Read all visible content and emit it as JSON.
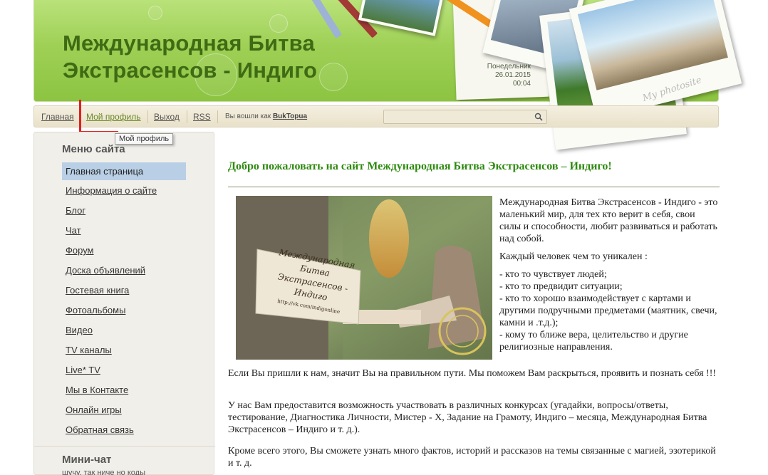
{
  "header": {
    "title_line1": "Международная Битва",
    "title_line2": "Экстрасенсов - Индиго",
    "weekday": "Понедельник",
    "date": "26.01.2015",
    "time": "00:04",
    "photo_caption": "My photosite"
  },
  "nav": {
    "home": "Главная",
    "profile": "Мой профиль",
    "logout": "Выход",
    "rss": "RSS",
    "logged_in_prefix": "Вы вошли как",
    "username": "BukTopua",
    "search_placeholder": "",
    "tooltip": "Мой профиль"
  },
  "sidebar": {
    "menu_title": "Меню сайта",
    "items": [
      {
        "label": "Главная страница"
      },
      {
        "label": "Информация о сайте"
      },
      {
        "label": "Блог"
      },
      {
        "label": "Чат"
      },
      {
        "label": "Форум"
      },
      {
        "label": "Доска объявлений"
      },
      {
        "label": "Гостевая книга"
      },
      {
        "label": "Фотоальбомы"
      },
      {
        "label": "Видео"
      },
      {
        "label": "TV каналы"
      },
      {
        "label": "Live* TV"
      },
      {
        "label": "Мы в Контакте"
      },
      {
        "label": "Онлайн игры"
      },
      {
        "label": "Обратная связь"
      }
    ],
    "minichat_title": "Мини-чат",
    "minichat_preview": "шучу. так ниче но коды"
  },
  "content": {
    "welcome": "Добро пожаловать на сайт  Международная Битва Экстрасенсов – Индиго!",
    "sign_text_1": "Международная Битва",
    "sign_text_2": "Экстрасенсов - Индиго",
    "sign_url": "http://vk.com/indigonline",
    "intro_p1": "Международная Битва Экстрасенсов - Индиго - это маленький мир, для тех кто верит в себя, свои силы и способности, любит развиваться и работать над собой.",
    "intro_p2": "Каждый человек чем то уникален :",
    "intro_list": [
      "- кто то чувствует людей;",
      "- кто то предвидит ситуации;",
      "- кто то хорошо взаимодействует с картами и другими подручными предметами (маятник, свечи, камни и .т.д.);",
      "- кому то ближе вера, целительство и другие религиозные направления."
    ],
    "para1": "Если Вы пришли к нам, значит Вы на правильном пути. Мы поможем Вам раскрыться, проявить и познать себя !!!",
    "para2": "У нас Вам предоставится возможность участвовать в различных конкурсах (угадайки, вопросы/ответы, тестирование, Диагностика Личности, Мистер - X, Задание на Грамоту, Индиго – месяца,  Международная Битва Экстрасенсов – Индиго и т. д.).",
    "para3": " Кроме всего этого, Вы сможете узнать много фактов, историй и рассказов на темы связанные с магией, эзотерикой и  т. д."
  }
}
